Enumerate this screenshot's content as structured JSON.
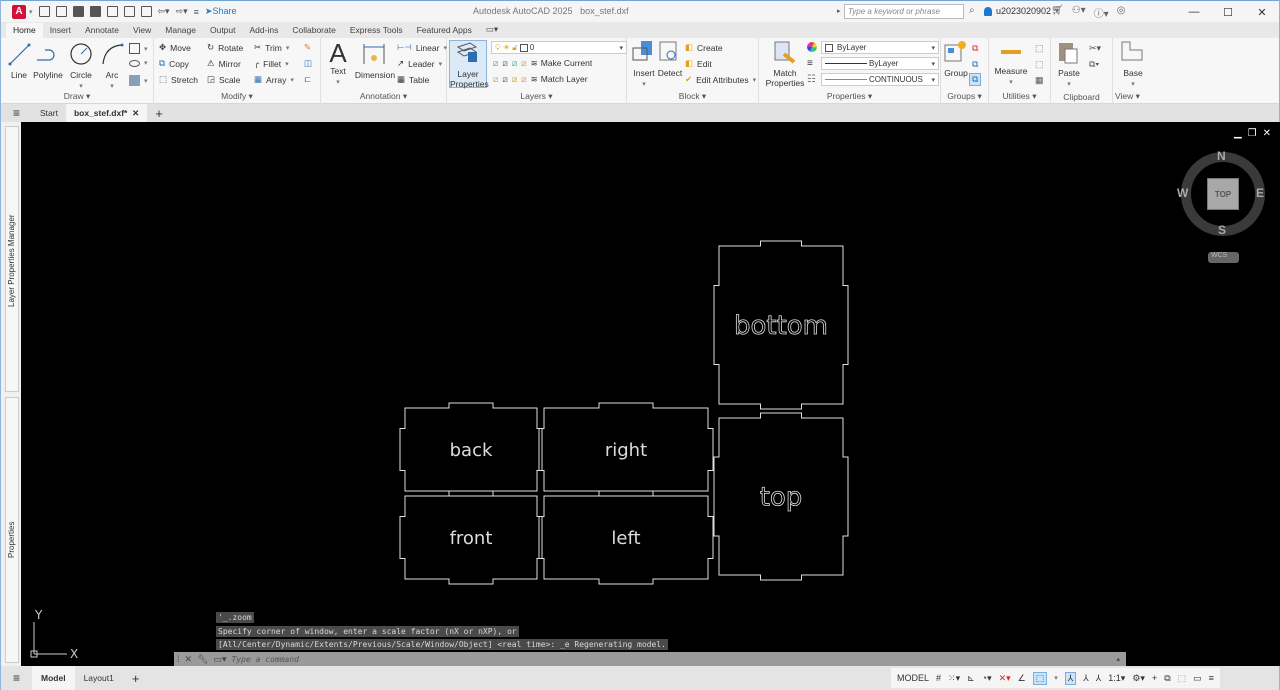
{
  "titlebar": {
    "logo": "A",
    "share_label": "Share",
    "app_title": "Autodesk AutoCAD 2025",
    "file_title": "box_stef.dxf",
    "search_placeholder": "Type a keyword or phrase",
    "username": "u2023020902",
    "quick_access_icons": [
      "new-icon",
      "open-icon",
      "save-icon",
      "save-as-icon",
      "plot-preview-icon",
      "import-icon",
      "plot-icon",
      "undo-icon",
      "redo-icon",
      "customize-icon"
    ]
  },
  "ribbon_tabs": [
    "Home",
    "Insert",
    "Annotate",
    "View",
    "Manage",
    "Output",
    "Add-ins",
    "Collaborate",
    "Express Tools",
    "Featured Apps"
  ],
  "active_ribbon_tab": "Home",
  "ribbon": {
    "draw": {
      "label": "Draw ▾",
      "line": "Line",
      "polyline": "Polyline",
      "circle": "Circle",
      "arc": "Arc"
    },
    "modify": {
      "label": "Modify ▾",
      "move": "Move",
      "rotate": "Rotate",
      "trim": "Trim",
      "copy": "Copy",
      "mirror": "Mirror",
      "fillet": "Fillet",
      "stretch": "Stretch",
      "scale": "Scale",
      "array": "Array"
    },
    "annotation": {
      "label": "Annotation ▾",
      "text": "Text",
      "dimension": "Dimension",
      "linear": "Linear",
      "leader": "Leader",
      "table": "Table"
    },
    "layers": {
      "label": "Layers ▾",
      "layer_properties_1": "Layer",
      "layer_properties_2": "Properties",
      "current_layer": "0",
      "make_current": "Make Current",
      "match_layer": "Match Layer"
    },
    "block": {
      "label": "Block ▾",
      "insert": "Insert",
      "detect": "Detect",
      "create": "Create",
      "edit": "Edit",
      "edit_attributes": "Edit Attributes"
    },
    "properties": {
      "label": "Properties ▾",
      "match_1": "Match",
      "match_2": "Properties",
      "color": "ByLayer",
      "lineweight": "ByLayer",
      "linetype": "CONTINUOUS"
    },
    "groups": {
      "label": "Groups ▾",
      "group": "Group"
    },
    "utilities": {
      "label": "Utilities ▾",
      "measure": "Measure"
    },
    "clipboard": {
      "label": "Clipboard",
      "paste": "Paste"
    },
    "view": {
      "label": "View ▾",
      "base": "Base"
    }
  },
  "doc_tabs": {
    "start": "Start",
    "active": "box_stef.dxf*"
  },
  "palettes": {
    "layer_manager": "Layer Properties Manager",
    "properties": "Properties"
  },
  "viewcube": {
    "n": "N",
    "s": "S",
    "e": "E",
    "w": "W",
    "face": "TOP",
    "ucs": "WCS"
  },
  "drawing": {
    "parts": [
      {
        "label": "bottom"
      },
      {
        "label": "back"
      },
      {
        "label": "right"
      },
      {
        "label": "top"
      },
      {
        "label": "front"
      },
      {
        "label": "left"
      }
    ],
    "ucs_x": "X",
    "ucs_y": "Y"
  },
  "command": {
    "history": [
      "'_.zoom",
      "Specify corner of window, enter a scale factor (nX or nXP), or",
      "[All/Center/Dynamic/Extents/Previous/Scale/Window/Object] <real time>: _e Regenerating model."
    ],
    "placeholder": "Type a command"
  },
  "layout_tabs": {
    "model": "Model",
    "layout1": "Layout1"
  },
  "status": {
    "model": "MODEL",
    "scale": "1:1"
  }
}
